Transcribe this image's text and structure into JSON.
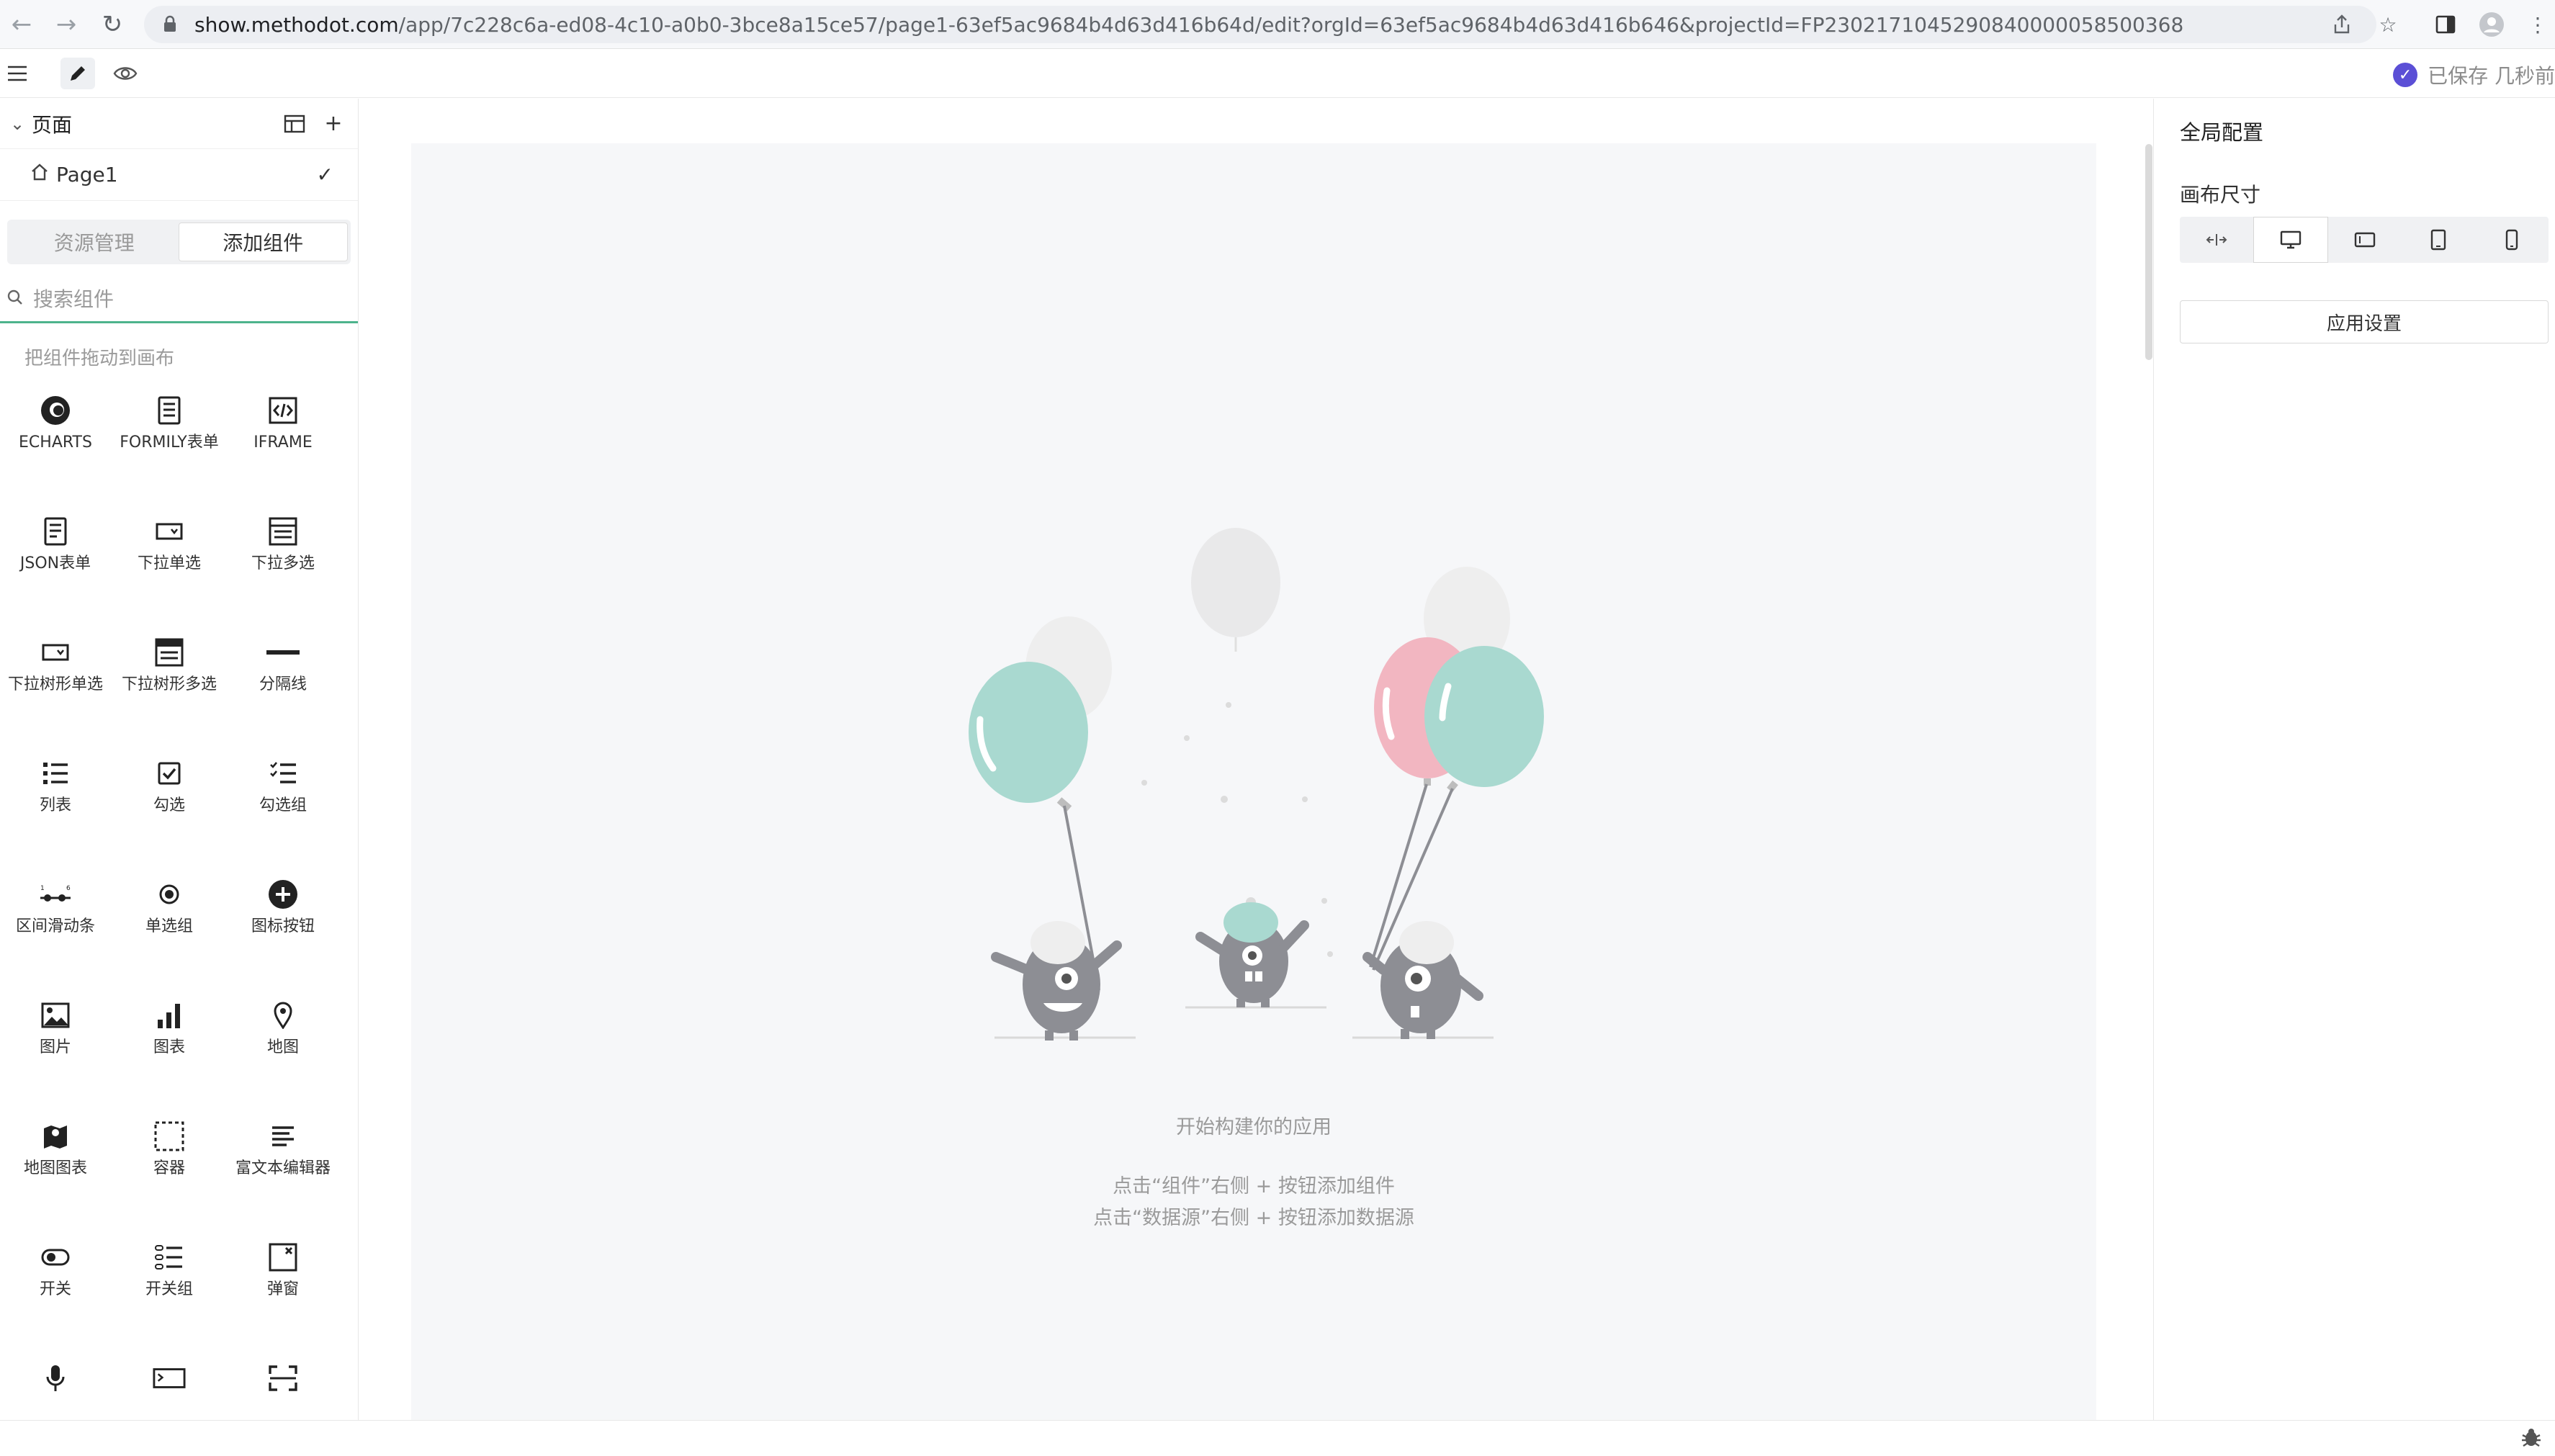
{
  "browser": {
    "url_host": "show.methodot.com",
    "url_path": "/app/7c228c6a-ed08-4c10-a0b0-3bce8a15ce57/page1-63ef5ac9684b4d63d416b64d/edit?orgId=63ef5ac9684b4d63d416b646&projectId=FP2302171045290840000058500368"
  },
  "toolbar": {
    "saved_text": "已保存 几秒前"
  },
  "pages": {
    "title": "页面",
    "items": [
      {
        "name": "Page1"
      }
    ]
  },
  "tabs": [
    {
      "label": "资源管理"
    },
    {
      "label": "添加组件"
    }
  ],
  "search": {
    "placeholder": "搜索组件"
  },
  "hint": "把组件拖动到画布",
  "components": [
    {
      "label": "ECHARTS",
      "icon": "echarts-icon"
    },
    {
      "label": "FORMILY表单",
      "icon": "form-icon"
    },
    {
      "label": "IFRAME",
      "icon": "iframe-icon"
    },
    {
      "label": "JSON表单",
      "icon": "json-form-icon"
    },
    {
      "label": "下拉单选",
      "icon": "select-icon"
    },
    {
      "label": "下拉多选",
      "icon": "multi-select-icon"
    },
    {
      "label": "下拉树形单选",
      "icon": "tree-select-icon"
    },
    {
      "label": "下拉树形多选",
      "icon": "tree-multi-select-icon"
    },
    {
      "label": "分隔线",
      "icon": "divider-icon"
    },
    {
      "label": "列表",
      "icon": "list-icon"
    },
    {
      "label": "勾选",
      "icon": "checkbox-icon"
    },
    {
      "label": "勾选组",
      "icon": "checkbox-group-icon"
    },
    {
      "label": "区间滑动条",
      "icon": "range-slider-icon"
    },
    {
      "label": "单选组",
      "icon": "radio-group-icon"
    },
    {
      "label": "图标按钮",
      "icon": "icon-button-icon"
    },
    {
      "label": "图片",
      "icon": "image-icon"
    },
    {
      "label": "图表",
      "icon": "chart-icon"
    },
    {
      "label": "地图",
      "icon": "map-pin-icon"
    },
    {
      "label": "地图图表",
      "icon": "map-chart-icon"
    },
    {
      "label": "容器",
      "icon": "container-icon"
    },
    {
      "label": "富文本编辑器",
      "icon": "rich-text-icon"
    },
    {
      "label": "开关",
      "icon": "switch-icon"
    },
    {
      "label": "开关组",
      "icon": "switch-group-icon"
    },
    {
      "label": "弹窗",
      "icon": "modal-icon"
    },
    {
      "label": "",
      "icon": "microphone-icon"
    },
    {
      "label": "",
      "icon": "terminal-icon"
    },
    {
      "label": "",
      "icon": "scan-icon"
    }
  ],
  "canvas": {
    "empty_title": "开始构建你的应用",
    "empty_lines": [
      "点击“组件”右侧 + 按钮添加组件",
      "点击“数据源”右侧 + 按钮添加数据源"
    ]
  },
  "right_panel": {
    "title": "全局配置",
    "canvas_size_label": "画布尺寸",
    "size_options": [
      "fluid-width-icon",
      "desktop-icon",
      "tablet-landscape-icon",
      "tablet-portrait-icon",
      "phone-icon"
    ],
    "app_settings_label": "应用设置"
  },
  "colors": {
    "accent_green": "#4db38c",
    "balloon_teal": "#a8d8cf",
    "balloon_pink": "#f2b6c1",
    "saved_check": "#5b4fd6"
  }
}
